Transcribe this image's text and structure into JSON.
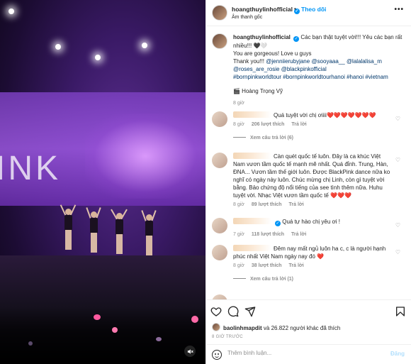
{
  "media": {
    "screen_text": "INK",
    "mute_icon": "speaker-muted-icon"
  },
  "header": {
    "username": "hoangthuylinhofficial",
    "follow_label": "Theo dõi",
    "separator": "•",
    "audio": "Âm thanh gốc",
    "more": "•••"
  },
  "caption": {
    "username": "hoangthuylinhofficial",
    "text": "Các bạn thật tuyệt vời!!! Yêu các bạn rất nhiều!!! 🖤🤍",
    "line2": "You are gorgeous! Love u guys",
    "thanks": "Thank you!!!",
    "mentions": [
      "@jenniierubyjane",
      "@sooyaaa__",
      "@lalalalisa_m",
      "@roses_are_rosie",
      "@blackpinkofficial"
    ],
    "hashtags": "#bornpinkworldtour #bornpinkworldtourhanoi #hanoi #vietnam",
    "location": "🎬 Hoàng Trọng Vỹ",
    "time": "8 giờ"
  },
  "comments": [
    {
      "text": "Quá tuyệt vời chị ơiiii❤️❤️❤️❤️❤️❤️❤️",
      "time": "8 giờ",
      "likes": "206 lượt thích",
      "reply": "Trả lời",
      "view_replies": "Xem câu trả lời (6)"
    },
    {
      "text": "Càn quét quốc tế luôn. Đây là ca khúc Việt Nam vươn tầm quốc tế mạnh mẽ nhất. Quá đỉnh. Trung, Hàn, ĐNA... Vươn tầm thế giới luôn. Được BlackPink dance nữa ko nghĩ có ngày này luôn. Chúc mừng chị Linh, còn gì tuyệt vời bằng. Bảo chứng độ nổi tiếng của see tình thêm nữa. Huhu tuyệt vời. Nhạc Việt vươn tầm quốc tế ❤️❤️❤️",
      "time": "8 giờ",
      "likes": "89 lượt thích",
      "reply": "Trả lời"
    },
    {
      "text": "Quá tự hào chị yêu ơi !",
      "time": "7 giờ",
      "likes": "118 lượt thích",
      "reply": "Trả lời"
    },
    {
      "text": "Đêm nay mất ngủ luôn ha c, c là người hạnh phúc nhất Việt Nam ngày nay đó ❤️",
      "time": "8 giờ",
      "likes": "38 lượt thích",
      "reply": "Trả lời",
      "view_replies": "Xem câu trả lời (1)"
    }
  ],
  "actions": {
    "like_icon": "heart-icon",
    "comment_icon": "comment-icon",
    "share_icon": "share-icon",
    "save_icon": "bookmark-icon",
    "liked_user": "baolinhmapdit",
    "liked_rest": "và 26.822 người khác đã thích",
    "date": "8 GIỜ TRƯỚC",
    "comment_placeholder": "Thêm bình luận...",
    "post_label": "Đăng"
  }
}
